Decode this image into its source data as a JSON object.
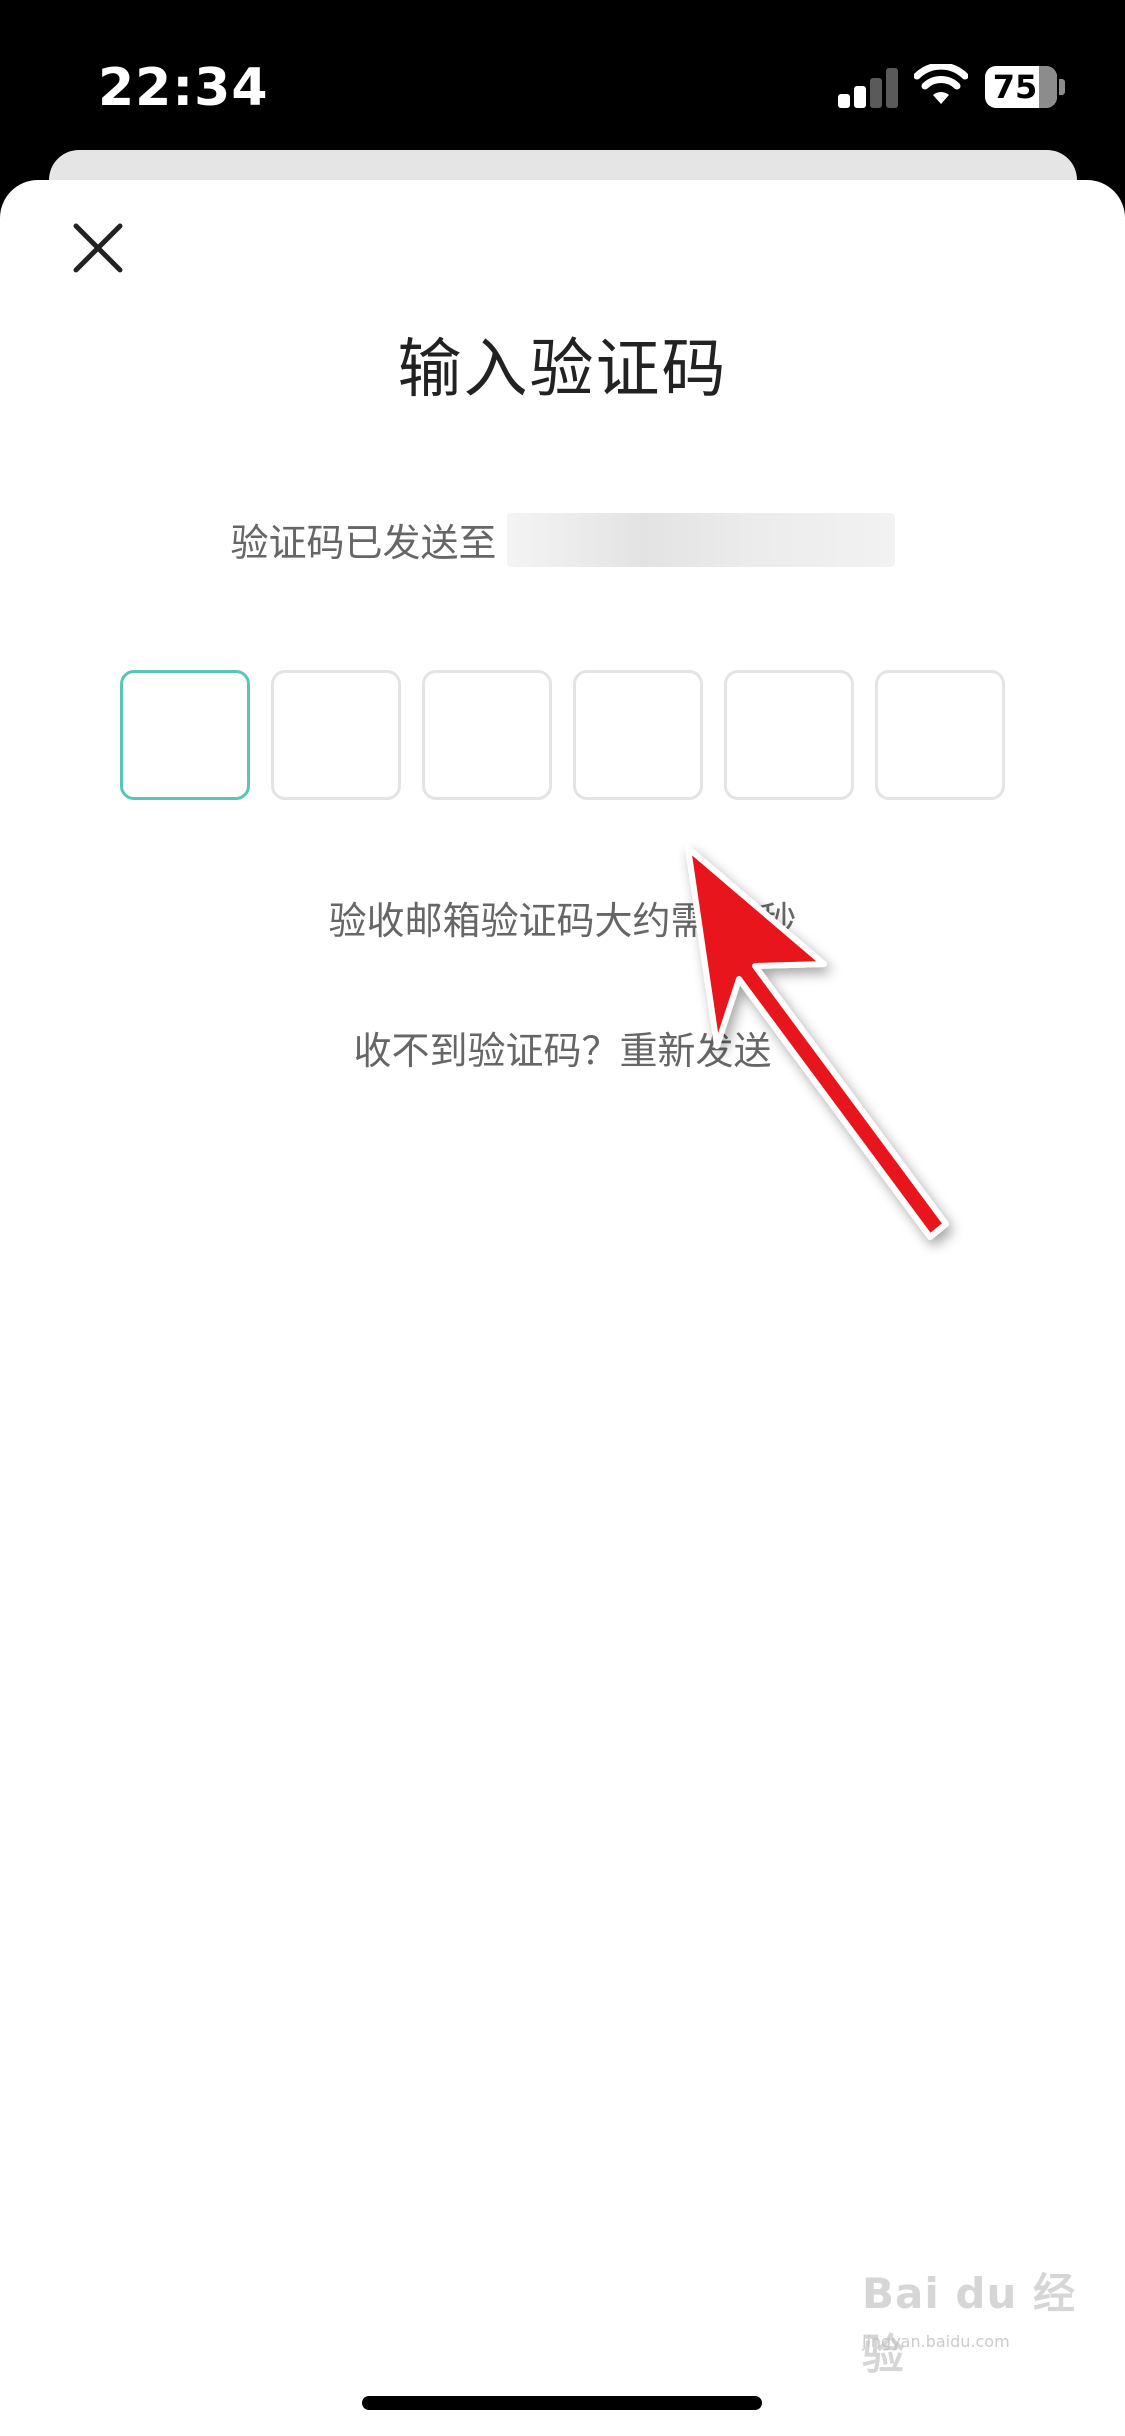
{
  "status_bar": {
    "time": "22:34",
    "battery_level": "75",
    "icons": [
      "cellular-signal-icon",
      "wifi-icon",
      "battery-icon"
    ]
  },
  "modal": {
    "close_icon": "close-icon",
    "title": "输入验证码",
    "sent_label": "验证码已发送至",
    "code_length": 6,
    "code_values": [
      "",
      "",
      "",
      "",
      "",
      ""
    ],
    "hint": "验收邮箱验证码大约需要 秒",
    "resend": "收不到验证码？重新发送"
  },
  "annotation": {
    "type": "red-arrow",
    "color": "#e8141c"
  },
  "watermark": {
    "brand": "Bai du 经验",
    "url": "jingyan.baidu.com"
  },
  "colors": {
    "accent": "#57c6b8",
    "box_border": "#e4e4e4",
    "text_secondary": "#666666",
    "title": "#222222"
  }
}
